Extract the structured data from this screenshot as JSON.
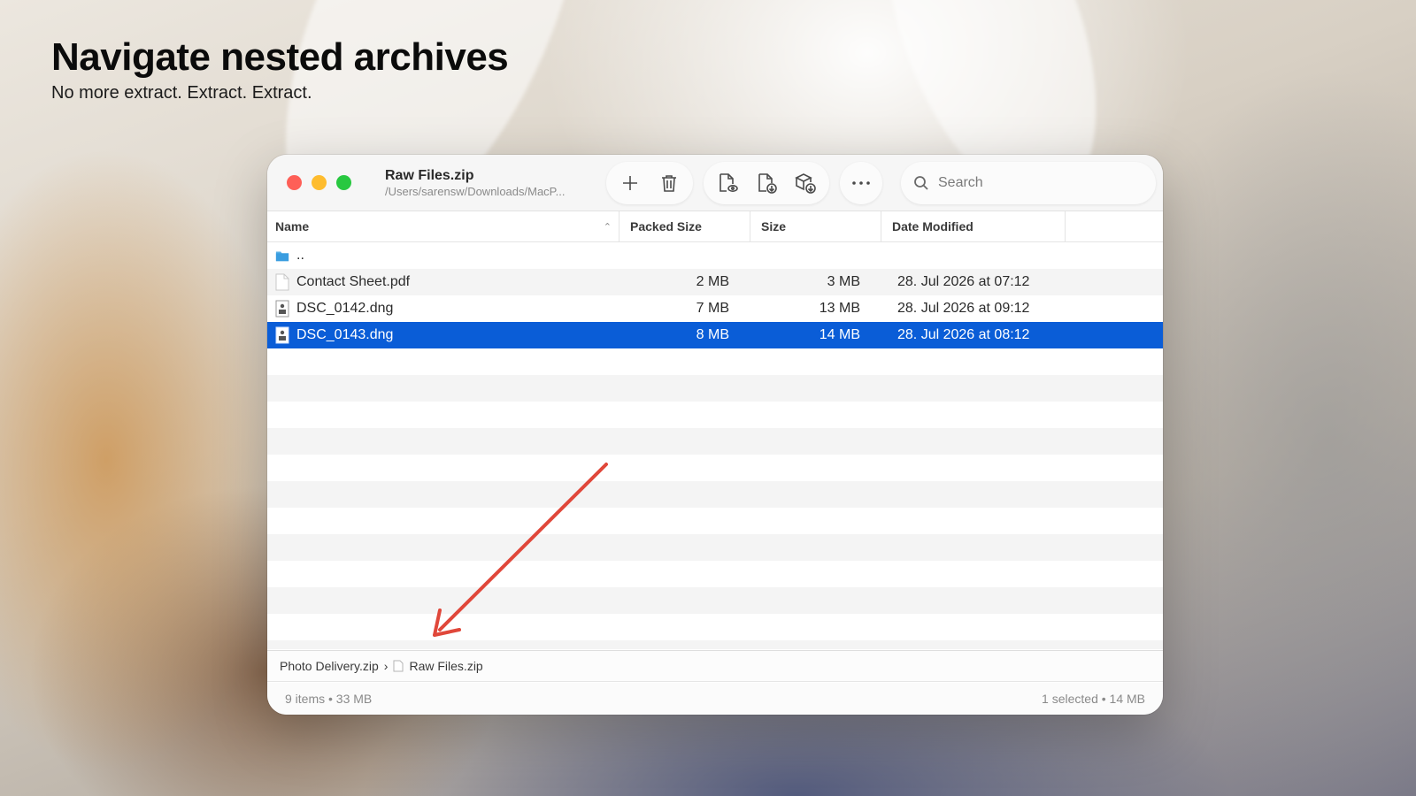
{
  "headline": {
    "title": "Navigate nested archives",
    "subtitle": "No more extract. Extract. Extract."
  },
  "window": {
    "title": "Raw Files.zip",
    "path": "/Users/sarensw/Downloads/MacP...",
    "toolbar": {
      "add_icon": "plus-icon",
      "delete_icon": "trash-icon",
      "preview_icon": "document-eye-icon",
      "extract_icon": "document-download-icon",
      "extract_all_icon": "box-download-icon",
      "more_icon": "ellipsis-icon"
    },
    "search": {
      "placeholder": "Search",
      "value": ""
    },
    "columns": {
      "name": "Name",
      "packed": "Packed Size",
      "size": "Size",
      "date": "Date Modified"
    },
    "rows": [
      {
        "name": "..",
        "packed": "",
        "size": "",
        "date": "",
        "icon": "folder-icon"
      },
      {
        "name": "Contact Sheet.pdf",
        "packed": "2 MB",
        "size": "3 MB",
        "date": "28. Jul 2026 at 07:12",
        "icon": "pdf-file-icon"
      },
      {
        "name": "DSC_0142.dng",
        "packed": "7 MB",
        "size": "13 MB",
        "date": "28. Jul 2026 at 09:12",
        "icon": "raw-image-file-icon"
      },
      {
        "name": "DSC_0143.dng",
        "packed": "8 MB",
        "size": "14 MB",
        "date": "28. Jul 2026 at 08:12",
        "icon": "raw-image-file-icon",
        "selected": true
      }
    ],
    "breadcrumb": {
      "parent": "Photo Delivery.zip",
      "separator": "›",
      "current": "Raw Files.zip"
    },
    "status": {
      "left": "9 items • 33 MB",
      "right": "1 selected • 14 MB"
    },
    "colors": {
      "selection": "#0a5dd7",
      "close": "#fe5f57",
      "minimize": "#febc2e",
      "zoom": "#28c840",
      "annotation_arrow": "#e0473a"
    }
  }
}
